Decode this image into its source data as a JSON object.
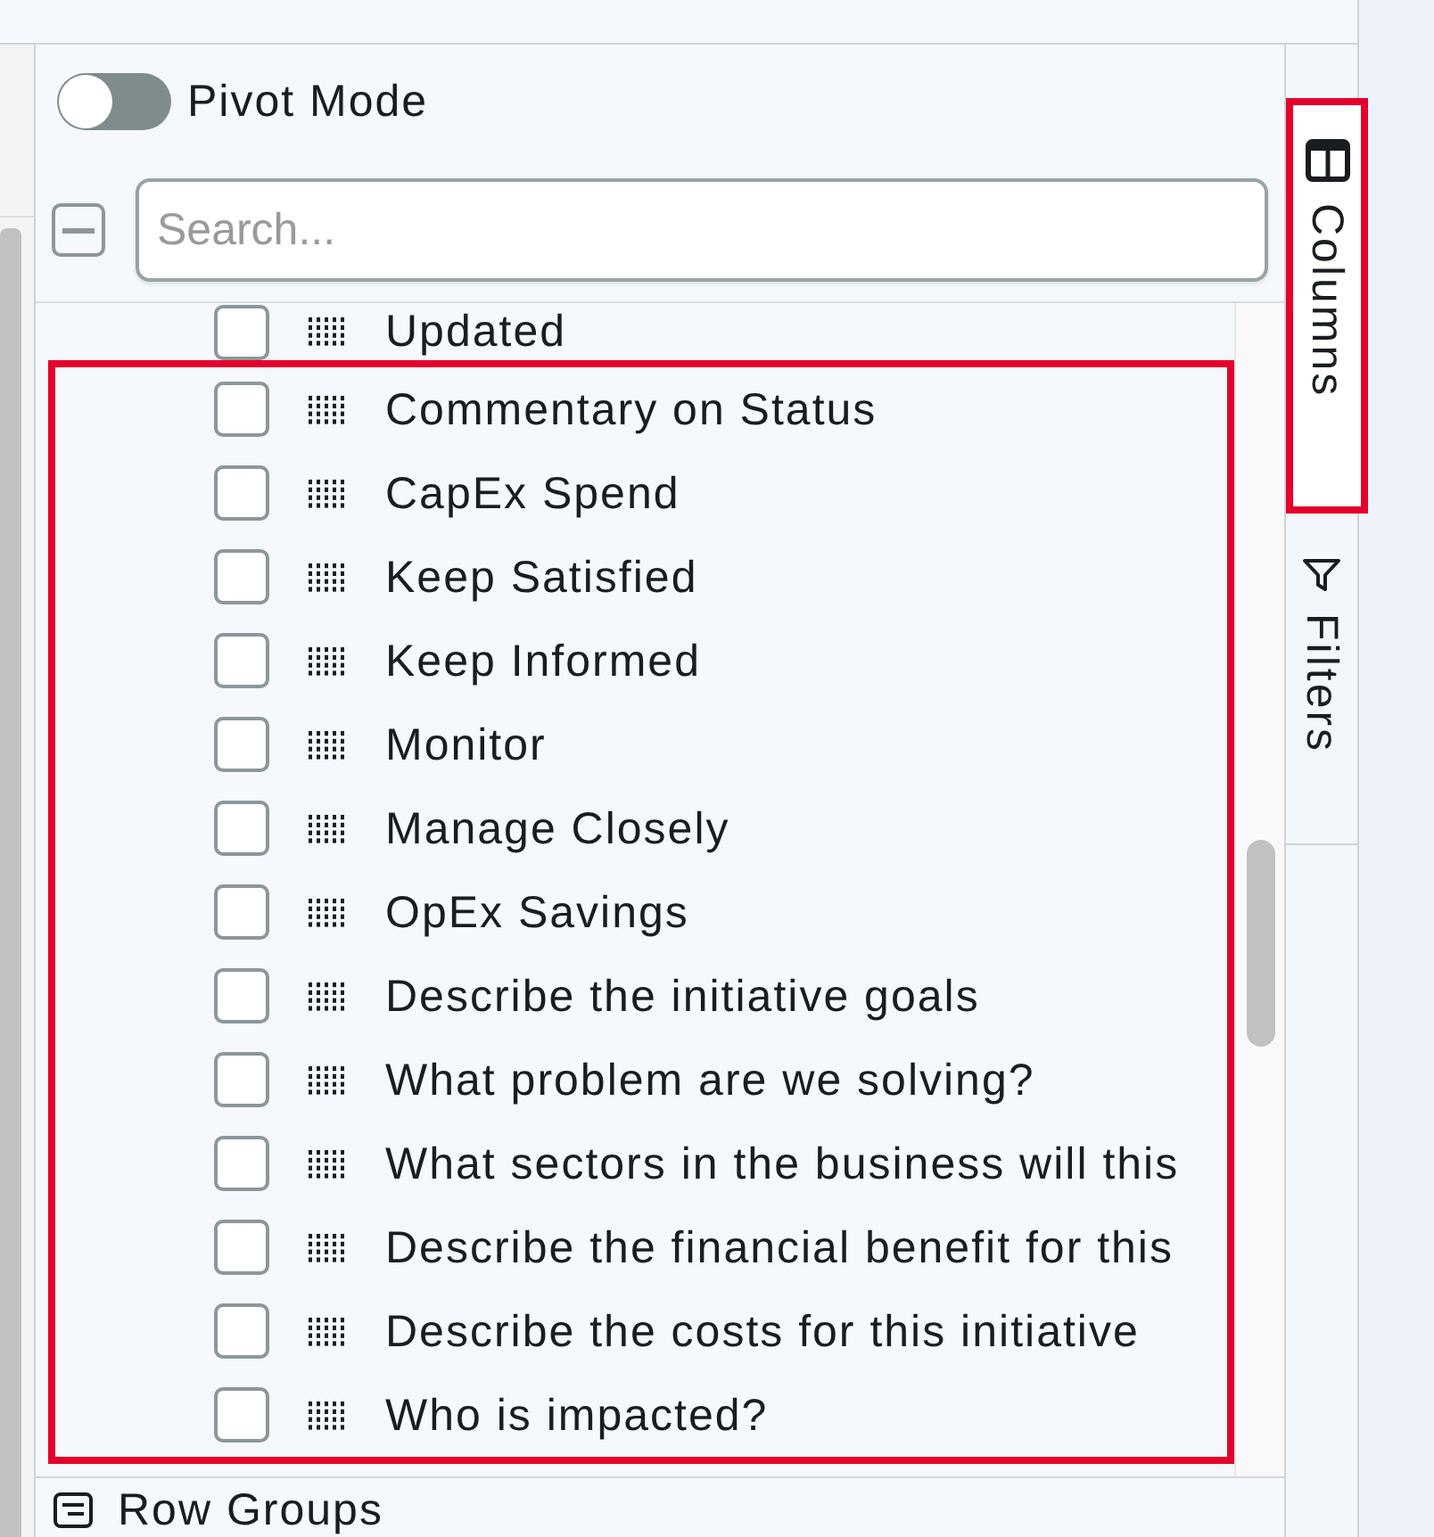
{
  "pivot_mode": {
    "label": "Pivot Mode",
    "on": false
  },
  "column_search": {
    "select_all": {
      "indeterminate": true
    },
    "placeholder": "Search..."
  },
  "columns": [
    {
      "label": "Updated",
      "checked": false
    }
  ],
  "highlight_box": {
    "outlined": true,
    "columns": [
      {
        "label": "Commentary on Status",
        "checked": false
      },
      {
        "label": "CapEx Spend",
        "checked": false
      },
      {
        "label": "Keep Satisfied",
        "checked": false
      },
      {
        "label": "Keep Informed",
        "checked": false
      },
      {
        "label": "Monitor",
        "checked": false
      },
      {
        "label": "Manage Closely",
        "checked": false
      },
      {
        "label": "OpEx Savings",
        "checked": false
      },
      {
        "label": "Describe the initiative goals",
        "checked": false
      },
      {
        "label": "What problem are we solving?",
        "checked": false
      },
      {
        "label": "What sectors in the business will this",
        "checked": false
      },
      {
        "label": "Describe the financial benefit for this",
        "checked": false
      },
      {
        "label": "Describe the costs for this initiative",
        "checked": false
      },
      {
        "label": "Who is impacted?",
        "checked": false
      }
    ]
  },
  "row_groups": {
    "label": "Row Groups"
  },
  "side_tabs": [
    {
      "label": "Columns",
      "kind": "columns",
      "selected": true,
      "outlined": true
    },
    {
      "label": "Filters",
      "kind": "filters",
      "selected": false,
      "outlined": false
    }
  ]
}
